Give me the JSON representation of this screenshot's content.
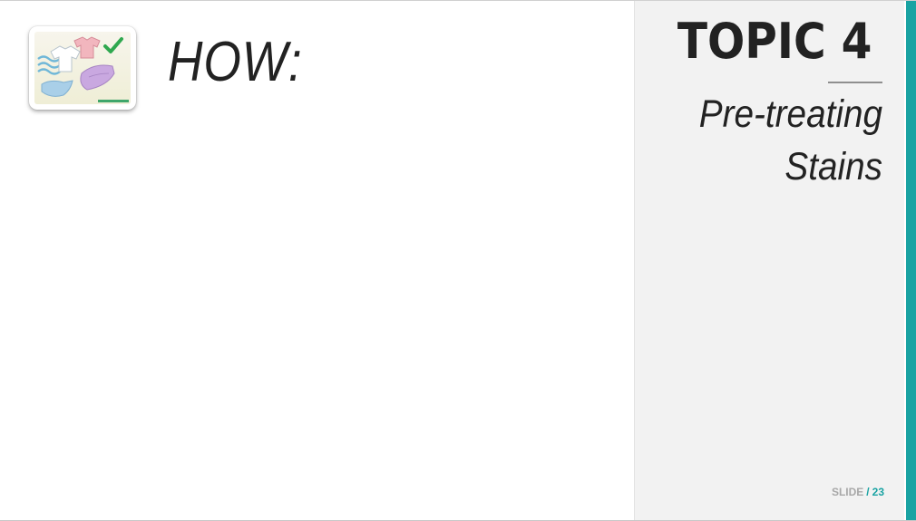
{
  "slide": {
    "heading": "HOW:",
    "thumbnail_icon": "laundry-clothes-checkmark-icon"
  },
  "sidebar": {
    "topic_label": "TOPIC 4",
    "topic_subtitle_line1": "Pre-treating",
    "topic_subtitle_line2": "Stains"
  },
  "footer": {
    "slide_label": "SLIDE",
    "separator": "/",
    "slide_number": "23"
  },
  "colors": {
    "accent": "#1aa3a3",
    "sidebar_bg": "#f2f2f2",
    "text": "#222222",
    "muted": "#a8a8a8",
    "check_green": "#2fa84f"
  }
}
